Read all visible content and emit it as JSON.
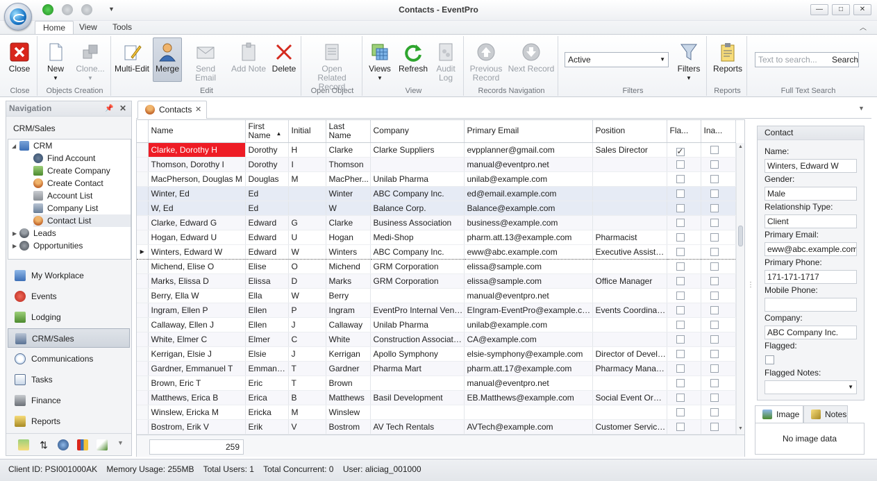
{
  "window": {
    "title": "Contacts - EventPro",
    "minimize": "—",
    "maximize": "□",
    "close": "✕"
  },
  "ribbon_tabs": [
    "Home",
    "View",
    "Tools"
  ],
  "groups": {
    "close": {
      "label": "Close",
      "buttons": [
        "Close"
      ]
    },
    "objects_creation": {
      "label": "Objects Creation",
      "new": "New",
      "clone": "Clone..."
    },
    "edit": {
      "label": "Edit",
      "multi_edit": "Multi-Edit",
      "merge": "Merge",
      "send_email": "Send Email",
      "add_note": "Add Note",
      "delete": "Delete"
    },
    "open_object": {
      "label": "Open Object",
      "open_related_1": "Open Related",
      "open_related_2": "Record"
    },
    "view": {
      "label": "View",
      "views": "Views",
      "refresh": "Refresh",
      "audit_1": "Audit",
      "audit_2": "Log"
    },
    "records_navigation": {
      "label": "Records Navigation",
      "previous_1": "Previous",
      "previous_2": "Record",
      "next": "Next Record"
    },
    "filters": {
      "label": "Filters",
      "combo_value": "Active",
      "filters_btn": "Filters"
    },
    "reports": {
      "label": "Reports",
      "reports_btn": "Reports"
    },
    "search": {
      "label": "Full Text Search",
      "placeholder": "Text to search...",
      "button": "Search"
    }
  },
  "navigation": {
    "header": "Navigation",
    "section_title": "CRM/Sales",
    "tree": {
      "crm": "CRM",
      "find_account": "Find Account",
      "create_company": "Create Company",
      "create_contact": "Create Contact",
      "account_list": "Account List",
      "company_list": "Company List",
      "contact_list": "Contact List",
      "leads": "Leads",
      "opportunities": "Opportunities"
    },
    "items": [
      "My Workplace",
      "Events",
      "Lodging",
      "CRM/Sales",
      "Communications",
      "Tasks",
      "Finance",
      "Reports"
    ]
  },
  "doc_tab": "Contacts",
  "grid": {
    "columns": [
      "Name",
      "First Name",
      "Initial",
      "Last Name",
      "Company",
      "Primary Email",
      "Position",
      "Fla...",
      "Ina..."
    ],
    "rows": [
      [
        "Clarke, Dorothy H",
        "Dorothy",
        "H",
        "Clarke",
        "Clarke Suppliers",
        "evpplanner@gmail.com",
        "Sales Director",
        true,
        false
      ],
      [
        "Thomson, Dorothy I",
        "Dorothy",
        "I",
        "Thomson",
        "",
        "manual@eventpro.net",
        "",
        false,
        false
      ],
      [
        "MacPherson, Douglas M",
        "Douglas",
        "M",
        "MacPher...",
        "Unilab Pharma",
        "unilab@example.com",
        "",
        false,
        false
      ],
      [
        "Winter, Ed",
        "Ed",
        "",
        "Winter",
        "ABC Company Inc.",
        "ed@email.example.com",
        "",
        false,
        false
      ],
      [
        "W, Ed",
        "Ed",
        "",
        "W",
        "Balance Corp.",
        "Balance@example.com",
        "",
        false,
        false
      ],
      [
        "Clarke, Edward G",
        "Edward",
        "G",
        "Clarke",
        "Business Association",
        "business@example.com",
        "",
        false,
        false
      ],
      [
        "Hogan, Edward U",
        "Edward",
        "U",
        "Hogan",
        "Medi-Shop",
        "pharm.att.13@example.com",
        "Pharmacist",
        false,
        false
      ],
      [
        "Winters, Edward W",
        "Edward",
        "W",
        "Winters",
        "ABC Company Inc.",
        "eww@abc.example.com",
        "Executive Assistant",
        false,
        false
      ],
      [
        "Michend, Elise O",
        "Elise",
        "O",
        "Michend",
        "GRM Corporation",
        "elissa@sample.com",
        "",
        false,
        false
      ],
      [
        "Marks, Elissa D",
        "Elissa",
        "D",
        "Marks",
        "GRM Corporation",
        "elissa@sample.com",
        "Office Manager",
        false,
        false
      ],
      [
        "Berry, Ella W",
        "Ella",
        "W",
        "Berry",
        "",
        "manual@eventpro.net",
        "",
        false,
        false
      ],
      [
        "Ingram, Ellen P",
        "Ellen",
        "P",
        "Ingram",
        "EventPro Internal Venue",
        "EIngram-EventPro@example.com",
        "Events Coordinator",
        false,
        false
      ],
      [
        "Callaway, Ellen J",
        "Ellen",
        "J",
        "Callaway",
        "Unilab Pharma",
        "unilab@example.com",
        "",
        false,
        false
      ],
      [
        "White, Elmer C",
        "Elmer",
        "C",
        "White",
        "Construction Association",
        "CA@example.com",
        "",
        false,
        false
      ],
      [
        "Kerrigan, Elsie J",
        "Elsie",
        "J",
        "Kerrigan",
        "Apollo Symphony",
        "elsie-symphony@example.com",
        "Director of Develo...",
        false,
        false
      ],
      [
        "Gardner, Emmanuel T",
        "Emmanuel",
        "T",
        "Gardner",
        "Pharma Mart",
        "pharm.att.17@example.com",
        "Pharmacy Manager",
        false,
        false
      ],
      [
        "Brown, Eric T",
        "Eric",
        "T",
        "Brown",
        "",
        "manual@eventpro.net",
        "",
        false,
        false
      ],
      [
        "Matthews, Erica B",
        "Erica",
        "B",
        "Matthews",
        "Basil Development",
        "EB.Matthews@example.com",
        "Social Event Orga...",
        false,
        false
      ],
      [
        "Winslew, Ericka M",
        "Ericka",
        "M",
        "Winslew",
        "",
        "",
        "",
        false,
        false
      ],
      [
        "Bostrom, Erik V",
        "Erik",
        "V",
        "Bostrom",
        "AV Tech Rentals",
        "AVTech@example.com",
        "Customer Service ...",
        false,
        false
      ]
    ],
    "record_count": "259"
  },
  "detail": {
    "header": "Contact",
    "name_label": "Name:",
    "name": "Winters, Edward W",
    "gender_label": "Gender:",
    "gender": "Male",
    "relationship_label": "Relationship Type:",
    "relationship": "Client",
    "email_label": "Primary Email:",
    "email": "eww@abc.example.com",
    "phone_label": "Primary Phone:",
    "phone": "171-171-1717",
    "mobile_label": "Mobile Phone:",
    "mobile": "",
    "company_label": "Company:",
    "company": "ABC Company Inc.",
    "flagged_label": "Flagged:",
    "flagged_notes_label": "Flagged Notes:"
  },
  "image_tabs": {
    "image": "Image",
    "notes": "Notes",
    "no_image": "No image data"
  },
  "status": {
    "client_id": "Client ID: PSI001000AK",
    "memory": "Memory Usage: 255MB",
    "total_users": "Total Users: 1",
    "total_concurrent": "Total Concurrent: 0",
    "user": "User: aliciag_001000"
  }
}
